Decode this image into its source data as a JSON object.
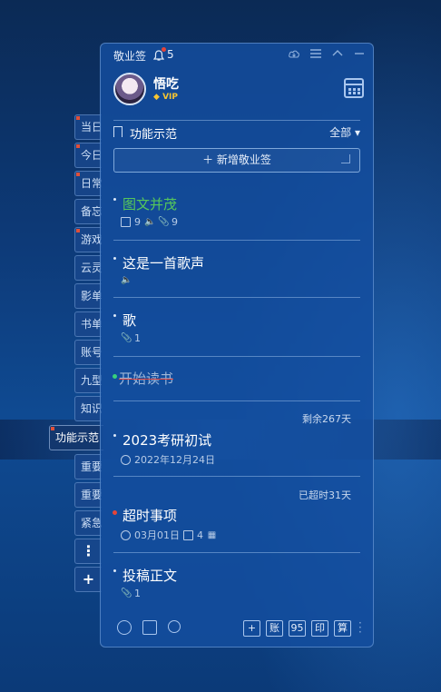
{
  "app": {
    "title": "敬业签",
    "bell_count": "5"
  },
  "profile": {
    "name": "悟吃",
    "vip": "VIP"
  },
  "section": {
    "title": "功能示范",
    "filter": "全部 ▾"
  },
  "add_button": "＋ 新增敬业签",
  "tabs": [
    {
      "label": "当日",
      "marked": true
    },
    {
      "label": "今日",
      "marked": true
    },
    {
      "label": "日常",
      "marked": true
    },
    {
      "label": "备忘",
      "marked": false
    },
    {
      "label": "游戏",
      "marked": true
    },
    {
      "label": "云灵",
      "marked": false
    },
    {
      "label": "影单",
      "marked": false
    },
    {
      "label": "书单",
      "marked": false
    },
    {
      "label": "账号",
      "marked": false
    },
    {
      "label": "九型",
      "marked": false
    },
    {
      "label": "知识",
      "marked": false
    },
    {
      "label": "功能示范",
      "marked": true,
      "active": true
    },
    {
      "label": "重要",
      "marked": false
    },
    {
      "label": "重要",
      "marked": false
    },
    {
      "label": "紧急",
      "marked": false
    },
    {
      "label": "⋮",
      "marked": false
    },
    {
      "label": "+",
      "marked": false
    }
  ],
  "notes": [
    {
      "title": "图文并茂",
      "style": "green",
      "img_count": "9",
      "attach_count": "9"
    },
    {
      "title": "这是一首歌声"
    },
    {
      "title": "歌",
      "attach_count": "1"
    },
    {
      "title": "开始读书",
      "style": "done"
    },
    {
      "title": "2023考研初试",
      "remain": "剩余267天",
      "date": "2022年12月24日"
    },
    {
      "title": "超时事项",
      "remain": "已超时31天",
      "date": "03月01日",
      "img_count": "4"
    },
    {
      "title": "投稿正文",
      "attach_count": "1"
    }
  ],
  "bottom_buttons": [
    "+",
    "账",
    "95",
    "印",
    "算"
  ]
}
